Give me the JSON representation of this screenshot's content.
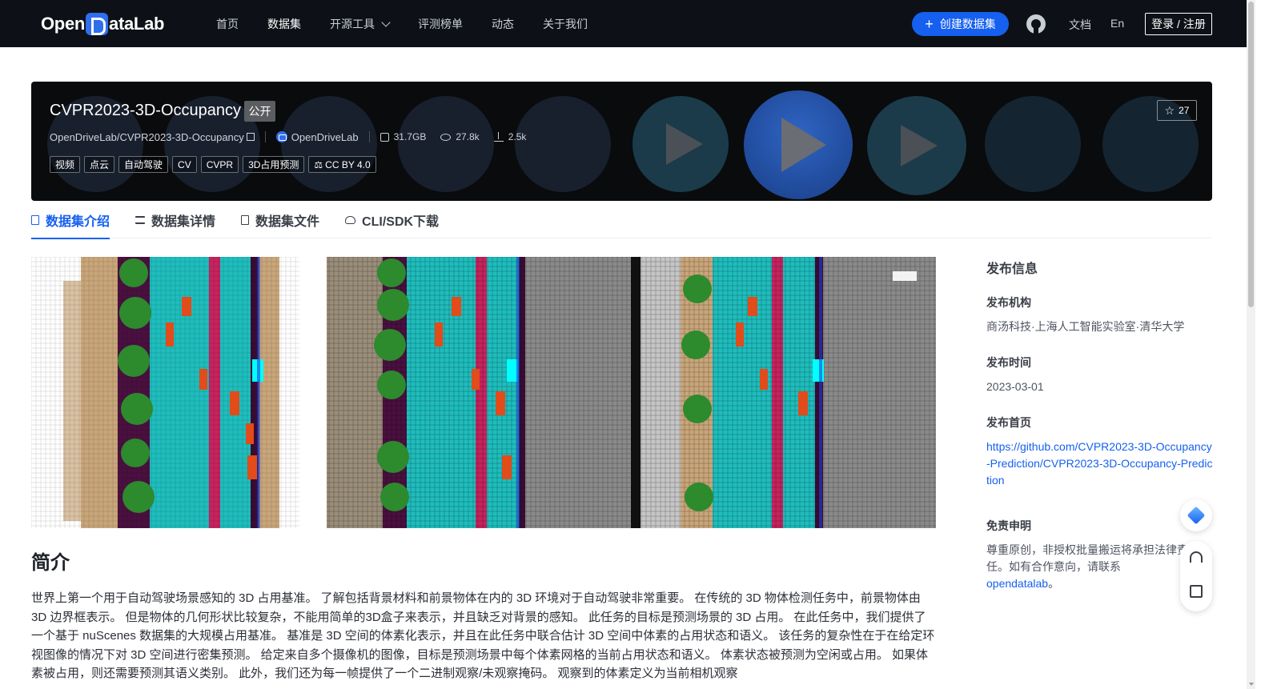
{
  "nav": {
    "logo": "OpenDataLab",
    "items": [
      "首页",
      "数据集",
      "开源工具",
      "评测榜单",
      "动态",
      "关于我们"
    ],
    "create_label": "创建数据集",
    "docs_label": "文档",
    "lang_label": "En",
    "login_label": "登录 / 注册"
  },
  "dataset": {
    "title": "CVPR2023-3D-Occupancy",
    "visibility": "公开",
    "repo": "OpenDriveLab/CVPR2023-3D-Occupancy",
    "org": "OpenDriveLab",
    "size": "31.7GB",
    "views": "27.8k",
    "downloads": "2.5k",
    "stars": "27",
    "tags": [
      "视频",
      "点云",
      "自动驾驶",
      "CV",
      "CVPR",
      "3D占用预测"
    ],
    "license": "CC BY 4.0"
  },
  "tabs": [
    "数据集介绍",
    "数据集详情",
    "数据集文件",
    "CLI/SDK下载"
  ],
  "intro": {
    "heading": "简介",
    "text": "世界上第一个用于自动驾驶场景感知的 3D 占用基准。 了解包括背景材料和前景物体在内的 3D 环境对于自动驾驶非常重要。 在传统的 3D 物体检测任务中，前景物体由 3D 边界框表示。 但是物体的几何形状比较复杂，不能用简单的3D盒子来表示，并且缺乏对背景的感知。 此任务的目标是预测场景的 3D 占用。 在此任务中，我们提供了一个基于 nuScenes 数据集的大规模占用基准。 基准是 3D 空间的体素化表示，并且在此任务中联合估计 3D 空间中体素的占用状态和语义。 该任务的复杂性在于在给定环视图像的情况下对 3D 空间进行密集预测。 给定来自多个摄像机的图像，目标是预测场景中每个体素网格的当前占用状态和语义。 体素状态被预测为空闲或占用。 如果体素被占用，则还需要预测其语义类别。 此外，我们还为每一帧提供了一个二进制观察/未观察掩码。 观察到的体素定义为当前相机观察"
  },
  "side": {
    "heading": "发布信息",
    "org_label": "发布机构",
    "org_value": "商汤科技·上海人工智能实验室·清华大学",
    "date_label": "发布时间",
    "date_value": "2023-03-01",
    "home_label": "发布首页",
    "home_value": "https://github.com/CVPR2023-3D-Occupancy-Prediction/CVPR2023-3D-Occupancy-Prediction",
    "disclaimer_label": "免责申明",
    "disclaimer_text": "尊重原创，非授权批量搬运将承担法律责任。如有合作意向，请联系",
    "disclaimer_link": "opendatalab",
    "disclaimer_end": "。"
  },
  "colors": {
    "nav_bg": "#0d1117",
    "accent": "#1660f0",
    "banner_bg": "#0a0b0d"
  }
}
